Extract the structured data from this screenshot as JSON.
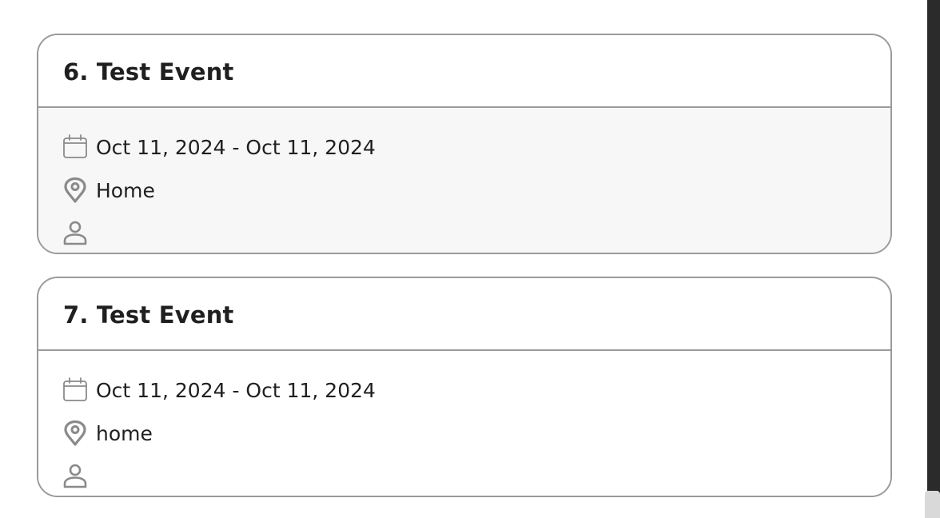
{
  "events": [
    {
      "title": "6. Test Event",
      "date_range": "Oct 11, 2024 - Oct 11, 2024",
      "location": "Home",
      "attendee": ""
    },
    {
      "title": "7. Test Event",
      "date_range": "Oct 11, 2024 - Oct 11, 2024",
      "location": "home",
      "attendee": ""
    }
  ],
  "icons": {
    "date": "calendar-icon",
    "location": "map-pin-icon",
    "person": "person-icon"
  },
  "colors": {
    "border": "#9a9a9a",
    "icon": "#8a8a8a",
    "body_bg_first": "#f7f7f7",
    "scrollbar_track": "#2b2b2b",
    "scrollbar_thumb": "#d9d9d9"
  }
}
